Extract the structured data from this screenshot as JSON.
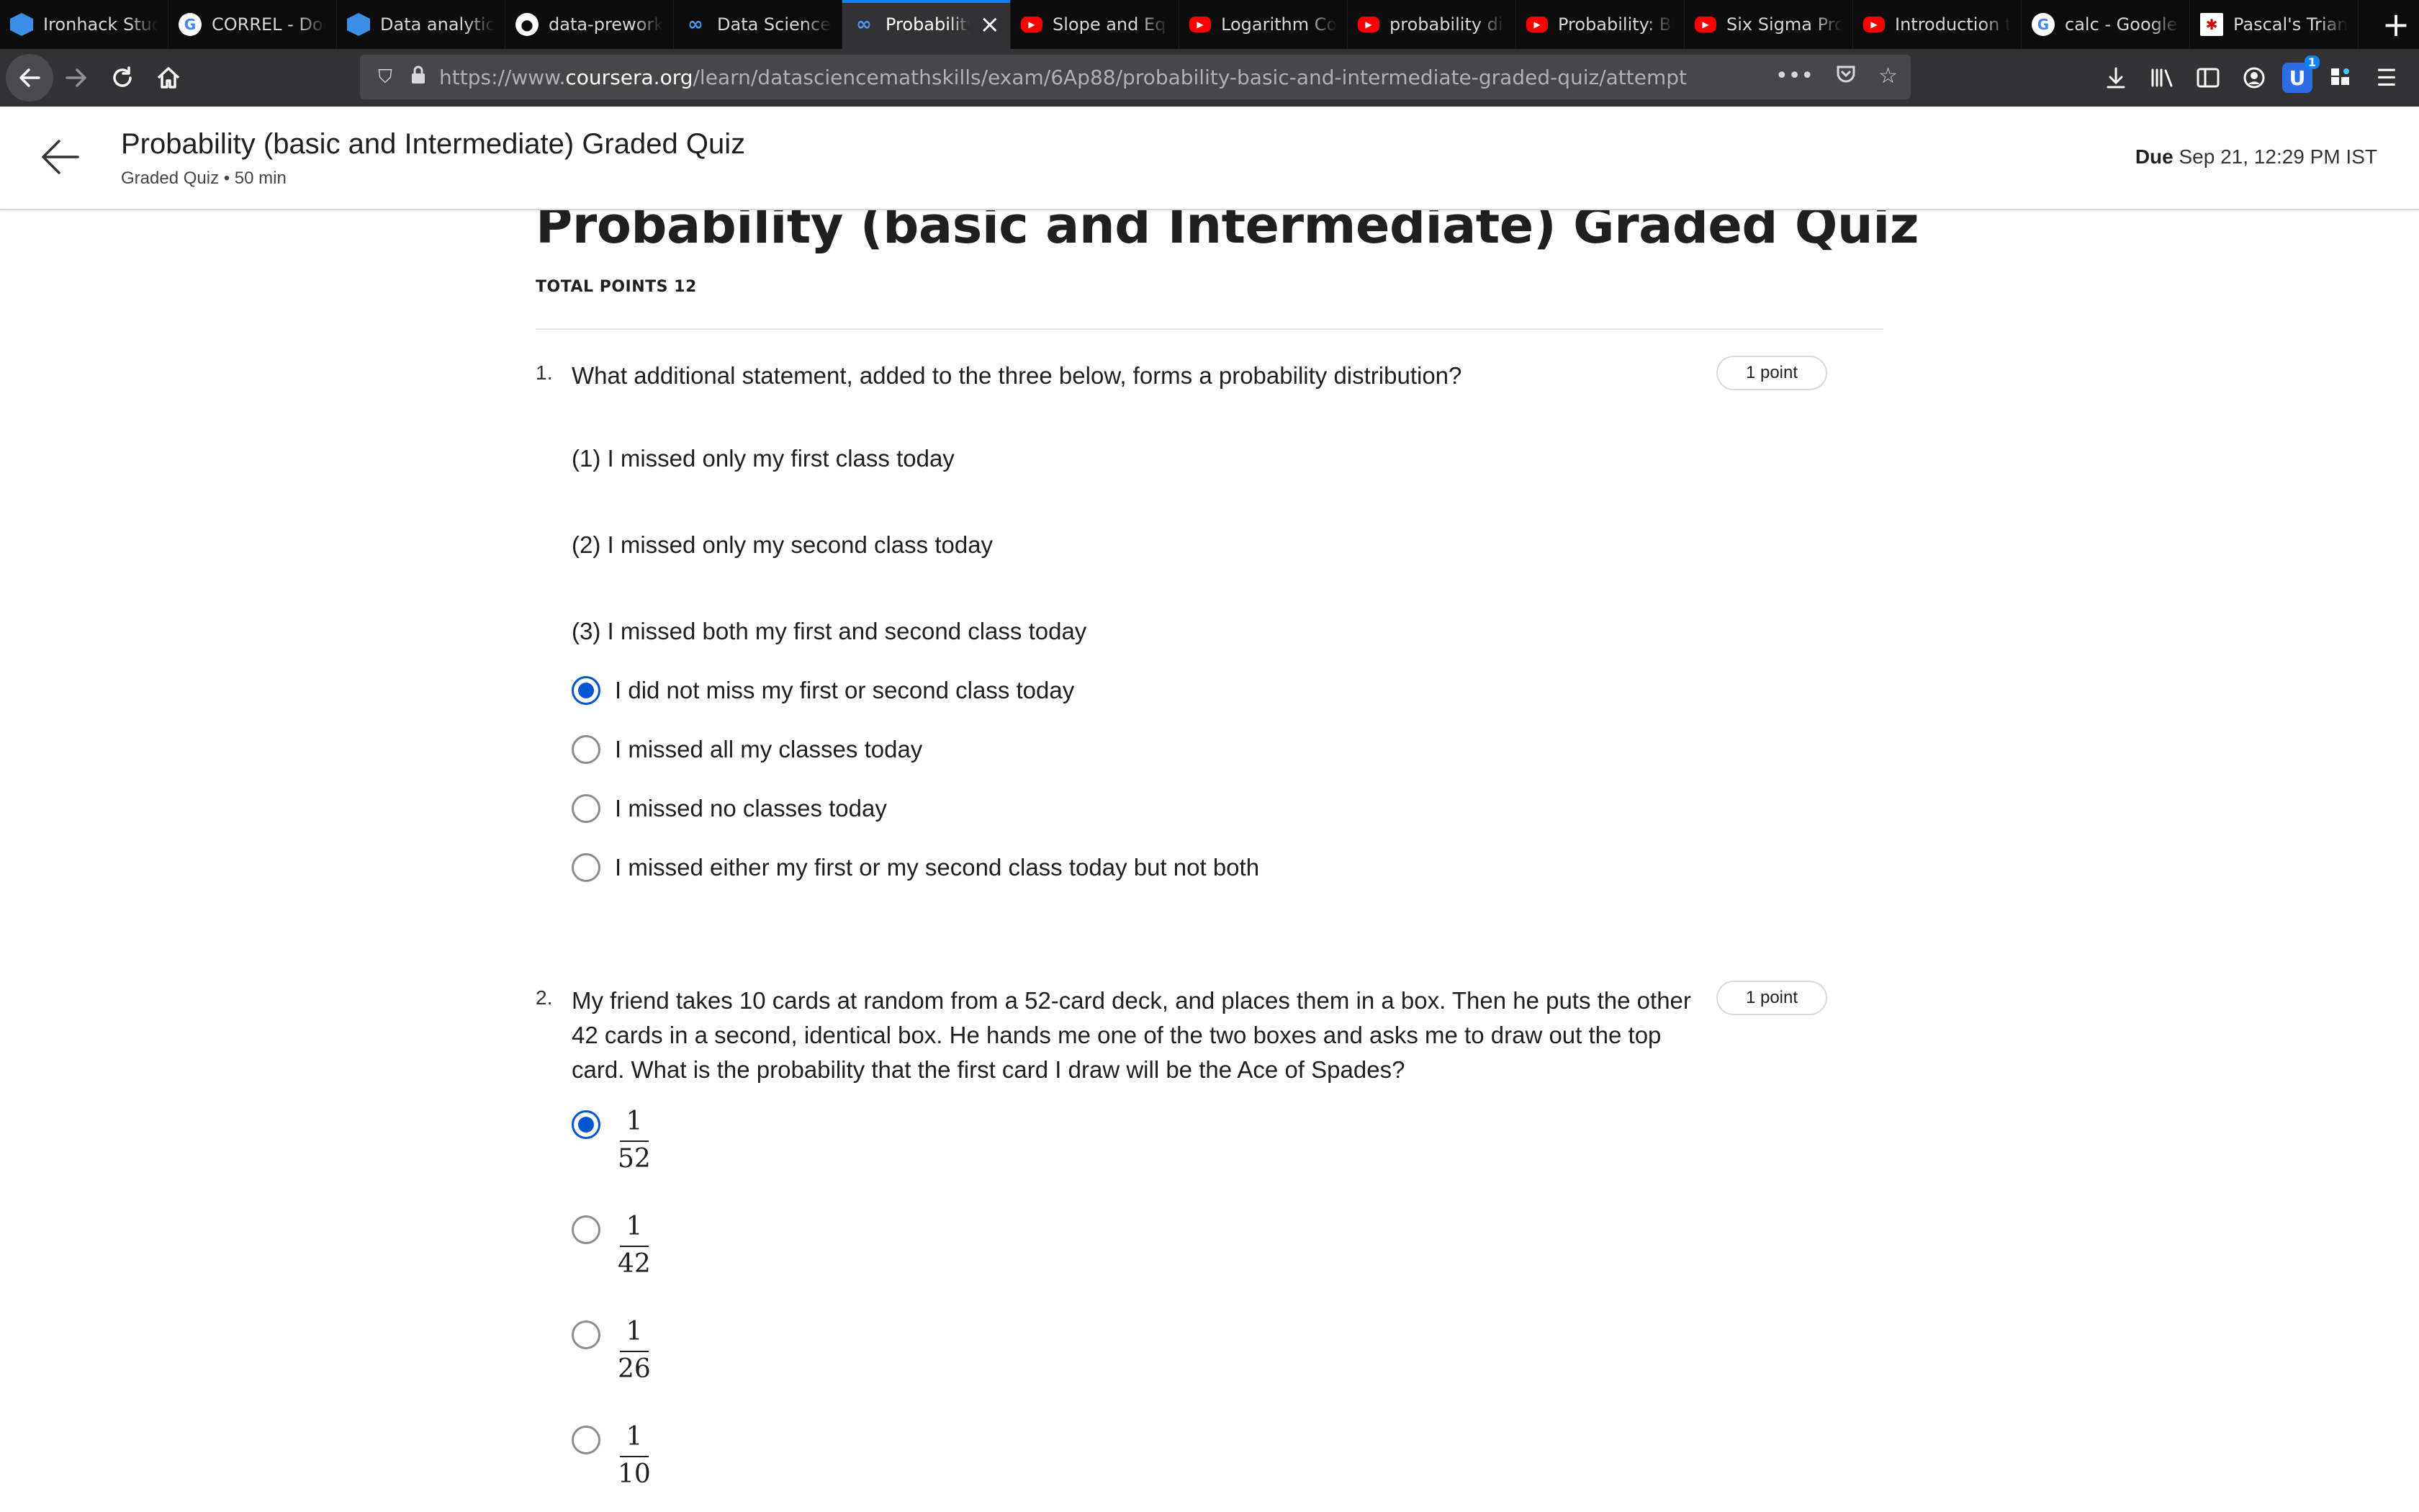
{
  "browser": {
    "tabs": [
      {
        "label": "Ironhack Stud",
        "icon": "ironhack-icon",
        "active": false
      },
      {
        "label": "CORREL - Doc",
        "icon": "google-icon",
        "active": false
      },
      {
        "label": "Data analytics",
        "icon": "ironhack-icon",
        "active": false
      },
      {
        "label": "data-prework/",
        "icon": "github-icon",
        "active": false
      },
      {
        "label": "Data Science",
        "icon": "coursera-icon",
        "active": false
      },
      {
        "label": "Probability",
        "icon": "coursera-icon",
        "active": true
      },
      {
        "label": "Slope and Equ",
        "icon": "youtube-icon",
        "active": false
      },
      {
        "label": "Logarithm Cor",
        "icon": "youtube-icon",
        "active": false
      },
      {
        "label": "probability dis",
        "icon": "youtube-icon",
        "active": false
      },
      {
        "label": "Probability: Bl",
        "icon": "youtube-icon",
        "active": false
      },
      {
        "label": "Six Sigma Pro",
        "icon": "youtube-icon",
        "active": false
      },
      {
        "label": "Introduction to",
        "icon": "youtube-icon",
        "active": false
      },
      {
        "label": "calc - Google",
        "icon": "google-icon",
        "active": false
      },
      {
        "label": "Pascal's Trian",
        "icon": "pascal-icon",
        "active": false
      }
    ],
    "url_prefix": "https://www.",
    "url_host": "coursera.org",
    "url_path": "/learn/datasciencemathskills/exam/6Ap88/probability-basic-and-intermediate-graded-quiz/attempt",
    "extension_badge": "1",
    "accent_color": "#0a84ff"
  },
  "header": {
    "title": "Probability (basic and Intermediate) Graded Quiz",
    "subtitle": "Graded Quiz • 50 min",
    "due_label": "Due",
    "due_value": "Sep 21, 12:29 PM IST"
  },
  "quiz": {
    "title": "Probability (basic and Intermediate) Graded Quiz",
    "total_points": "TOTAL POINTS 12",
    "selected_color": "#0056d2",
    "questions": [
      {
        "number": "1.",
        "text": "What additional statement, added to the three below, forms a probability distribution?",
        "points": "1 point",
        "statements": [
          "(1) I missed only my first class today",
          "(2) I missed only my second class today",
          "(3) I missed both my first and second class today"
        ],
        "options": [
          {
            "label": "I did not miss my first or second class today",
            "selected": true
          },
          {
            "label": "I missed all my classes today",
            "selected": false
          },
          {
            "label": "I missed no classes today",
            "selected": false
          },
          {
            "label": "I missed either my first or my second class today but not both",
            "selected": false
          }
        ]
      },
      {
        "number": "2.",
        "text": "My friend takes 10 cards at random from a 52-card deck, and places them in a box. Then he puts the other 42 cards in a second, identical box. He hands me one of the two boxes and asks me to draw out the top card. What is the probability that the first card I draw will be the Ace of Spades?",
        "points": "1 point",
        "options": [
          {
            "numerator": "1",
            "denominator": "52",
            "selected": true
          },
          {
            "numerator": "1",
            "denominator": "42",
            "selected": false
          },
          {
            "numerator": "1",
            "denominator": "26",
            "selected": false
          },
          {
            "numerator": "1",
            "denominator": "10",
            "selected": false
          }
        ]
      }
    ]
  }
}
